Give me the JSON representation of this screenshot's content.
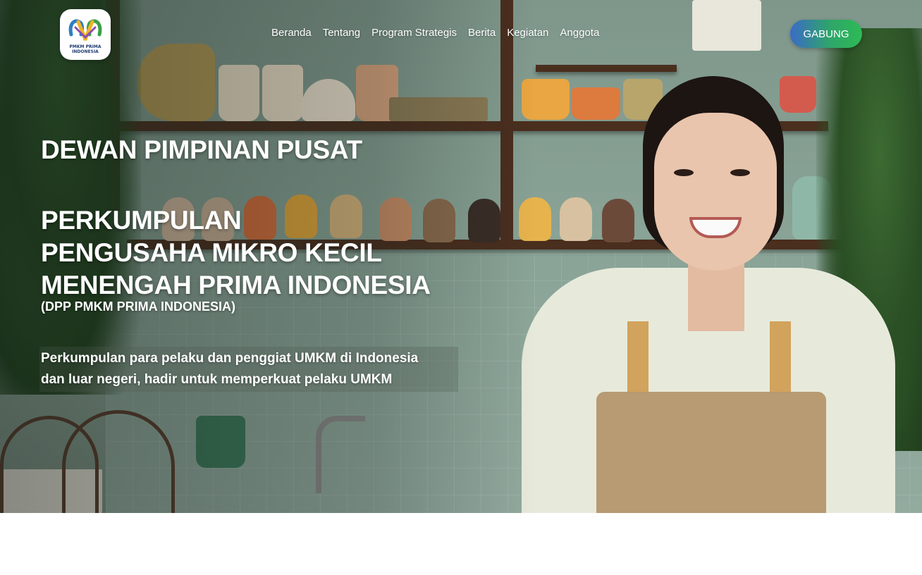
{
  "brand": {
    "logo_text": "PMKM PRIMA INDONESIA"
  },
  "nav": {
    "items": [
      "Beranda",
      "Tentang",
      "Program Strategis",
      "Berita",
      "Kegiatan",
      "Anggota"
    ],
    "cta_label": "GABUNG"
  },
  "hero": {
    "title_line1": "DEWAN PIMPINAN PUSAT",
    "title_lines": [
      "PERKUMPULAN",
      "PENGUSAHA MIKRO KECIL",
      "MENENGAH PRIMA INDONESIA"
    ],
    "abbreviation": "(DPP PMKM PRIMA INDONESIA)",
    "tagline_lines": [
      "Perkumpulan para pelaku dan penggiat UMKM di Indonesia",
      "dan luar negeri, hadir untuk memperkuat pelaku UMKM"
    ]
  },
  "colors": {
    "cta_gradient_start": "#3a6bc7",
    "cta_gradient_end": "#2dbb55",
    "text": "#ffffff"
  }
}
